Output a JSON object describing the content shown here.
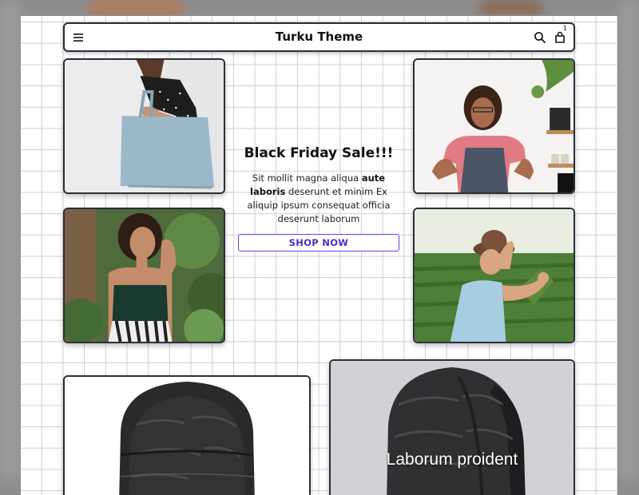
{
  "header": {
    "title": "Turku Theme",
    "cart_count": "1"
  },
  "promo": {
    "heading": "Black Friday Sale!!!",
    "text_before": "Sit mollit magna aliqua ",
    "text_bold": "aute laboris",
    "text_after": " deserunt et minim Ex aliquip ipsum consequat officia deserunt laborum",
    "button_label": "SHOP NOW"
  },
  "products": [
    {
      "title": ""
    },
    {
      "title": "Laborum proident"
    }
  ],
  "icons": {
    "menu": "hamburger-menu-icon",
    "search": "search-icon",
    "cart": "shopping-bag-icon"
  },
  "colors": {
    "button_border": "#6a3df0",
    "button_text": "#4b2cc8",
    "card_border": "#2b2f3a"
  }
}
